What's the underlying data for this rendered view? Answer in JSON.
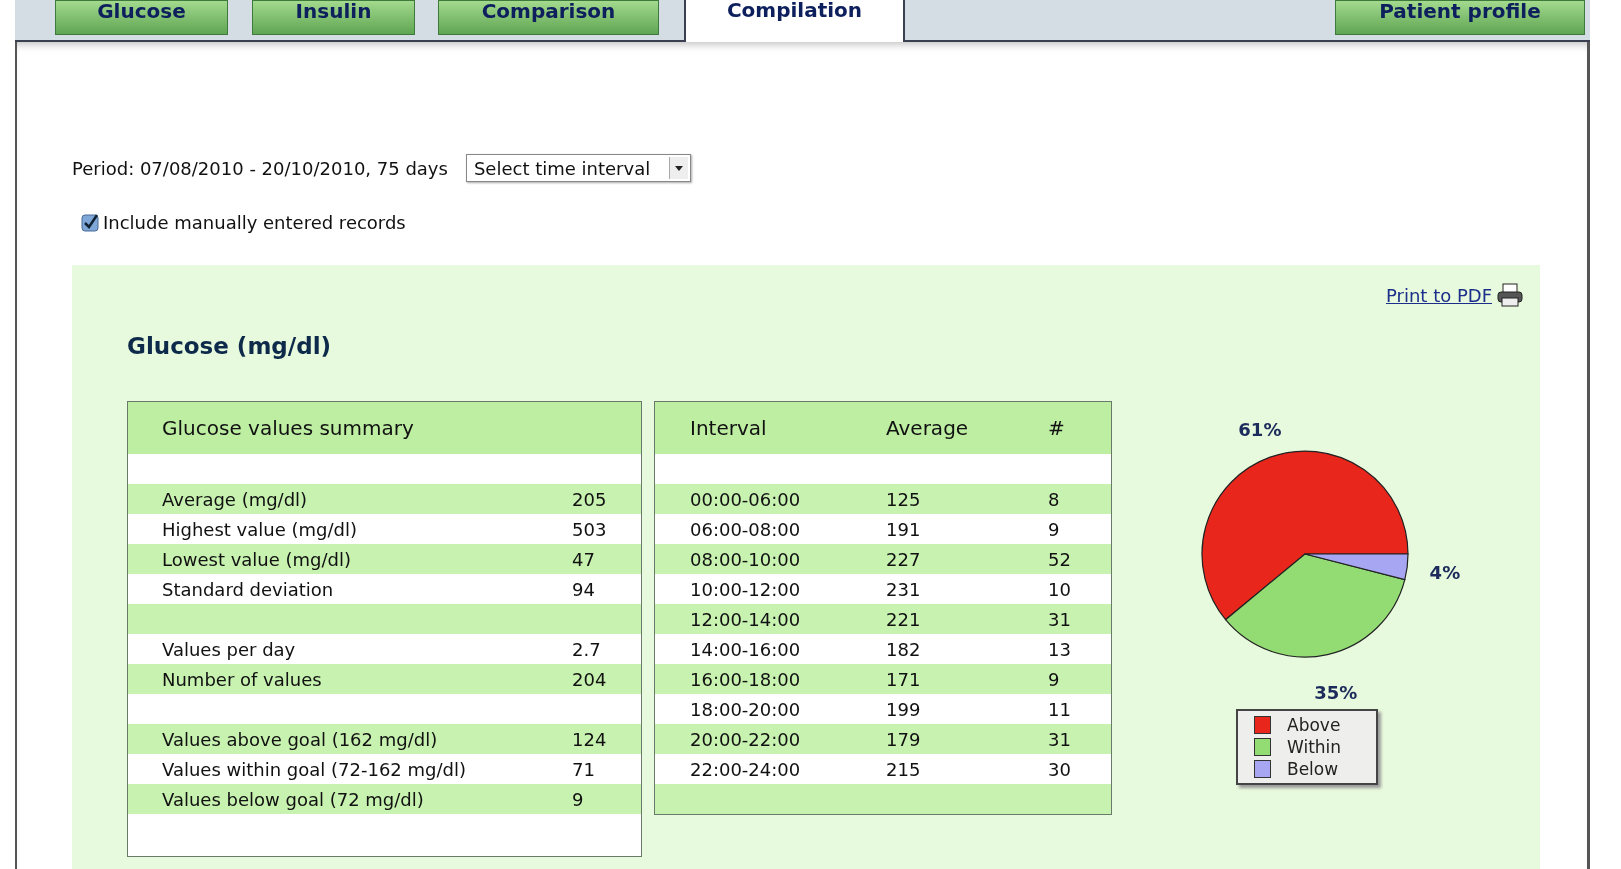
{
  "tabs": [
    {
      "label": "Glucose",
      "selected": false
    },
    {
      "label": "Insulin",
      "selected": false
    },
    {
      "label": "Comparison",
      "selected": false
    },
    {
      "label": "Compilation",
      "selected": true
    },
    {
      "label": "Patient profile",
      "selected": false
    }
  ],
  "period": {
    "text": "Period: 07/08/2010 - 20/10/2010, 75 days",
    "interval_select": {
      "value": "Select time interval"
    }
  },
  "include_manual": {
    "label": "Include manually entered records",
    "checked": true
  },
  "print_link": "Print to PDF",
  "heading": "Glucose (mg/dl)",
  "summary_table": {
    "title": "Glucose values summary",
    "rows": [
      {
        "kind": "blank"
      },
      {
        "kind": "value",
        "label": "Average (mg/dl)",
        "value": "205"
      },
      {
        "kind": "value",
        "label": "Highest value (mg/dl)",
        "value": "503"
      },
      {
        "kind": "value",
        "label": "Lowest value (mg/dl)",
        "value": "47"
      },
      {
        "kind": "value",
        "label": "Standard deviation",
        "value": "94"
      },
      {
        "kind": "blank"
      },
      {
        "kind": "value",
        "label": "Values per day",
        "value": "2.7"
      },
      {
        "kind": "value",
        "label": "Number of values",
        "value": "204"
      },
      {
        "kind": "blank"
      },
      {
        "kind": "value",
        "label": "Values above goal (162 mg/dl)",
        "value": "124"
      },
      {
        "kind": "value",
        "label": "Values within goal (72-162 mg/dl)",
        "value": "71"
      },
      {
        "kind": "value",
        "label": "Values below goal (72 mg/dl)",
        "value": "9"
      },
      {
        "kind": "blank"
      }
    ]
  },
  "interval_table": {
    "columns": [
      "Interval",
      "Average",
      "#"
    ],
    "rows": [
      {
        "kind": "blank"
      },
      {
        "kind": "value",
        "cells": [
          "00:00-06:00",
          "125",
          "8"
        ]
      },
      {
        "kind": "value",
        "cells": [
          "06:00-08:00",
          "191",
          "9"
        ]
      },
      {
        "kind": "value",
        "cells": [
          "08:00-10:00",
          "227",
          "52"
        ]
      },
      {
        "kind": "value",
        "cells": [
          "10:00-12:00",
          "231",
          "10"
        ]
      },
      {
        "kind": "value",
        "cells": [
          "12:00-14:00",
          "221",
          "31"
        ]
      },
      {
        "kind": "value",
        "cells": [
          "14:00-16:00",
          "182",
          "13"
        ]
      },
      {
        "kind": "value",
        "cells": [
          "16:00-18:00",
          "171",
          "9"
        ]
      },
      {
        "kind": "value",
        "cells": [
          "18:00-20:00",
          "199",
          "11"
        ]
      },
      {
        "kind": "value",
        "cells": [
          "20:00-22:00",
          "179",
          "31"
        ]
      },
      {
        "kind": "value",
        "cells": [
          "22:00-24:00",
          "215",
          "30"
        ]
      },
      {
        "kind": "blank"
      }
    ]
  },
  "pie": {
    "chart_data": {
      "type": "pie",
      "categories": [
        "Above",
        "Within",
        "Below"
      ],
      "legend": true,
      "series": [
        {
          "values": [
            61,
            35,
            4
          ]
        }
      ],
      "value_labels": [
        "61%",
        "35%",
        "4%"
      ],
      "colors": [
        "#e8261c",
        "#93dc74",
        "#a6a6f2"
      ]
    }
  }
}
